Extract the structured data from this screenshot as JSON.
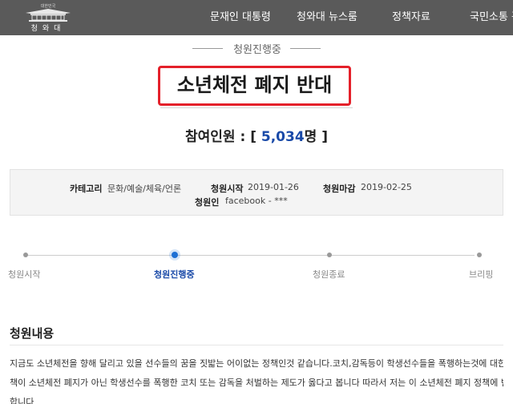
{
  "header": {
    "logo_small": "대한민국",
    "logo_name": "청와대",
    "nav": [
      "문재인 대통령",
      "청와대 뉴스룸",
      "정책자료",
      "국민소통 광"
    ]
  },
  "petition": {
    "status": "청원진행중",
    "title": "소년체전 폐지 반대",
    "participants_label": "참여인원 : [ ",
    "participants_count": "5,034",
    "participants_unit": "명 ]"
  },
  "info": {
    "category_label": "카테고리",
    "category_value": "문화/예술/체육/언론",
    "start_label": "청원시작",
    "start_value": "2019-01-26",
    "end_label": "청원마감",
    "end_value": "2019-02-25",
    "author_label": "청원인",
    "author_value": "facebook - ***"
  },
  "progress": {
    "steps": [
      "청원시작",
      "청원진행중",
      "청원종료",
      "브리핑"
    ],
    "active_index": 1
  },
  "content": {
    "heading": "청원내용",
    "lines": [
      "지금도 소년체전을 향해 달리고 있을 선수들의 꿈을 짓밟는 어이없는 정책인것 같습니다.코치,감독등이 학생선수들을 폭행하는것에 대한 정",
      "책이 소년체전 폐지가 아닌 학생선수를 폭행한 코치 또는 감독을 처벌하는 제도가 옳다고 봅니다 따라서 저는 이 소년체전 폐지 정책에 반대",
      "합니다"
    ]
  },
  "colors": {
    "header_bg": "#5a5a5a",
    "highlight_border": "#e4202a",
    "accent_blue": "#1a4aa8"
  }
}
